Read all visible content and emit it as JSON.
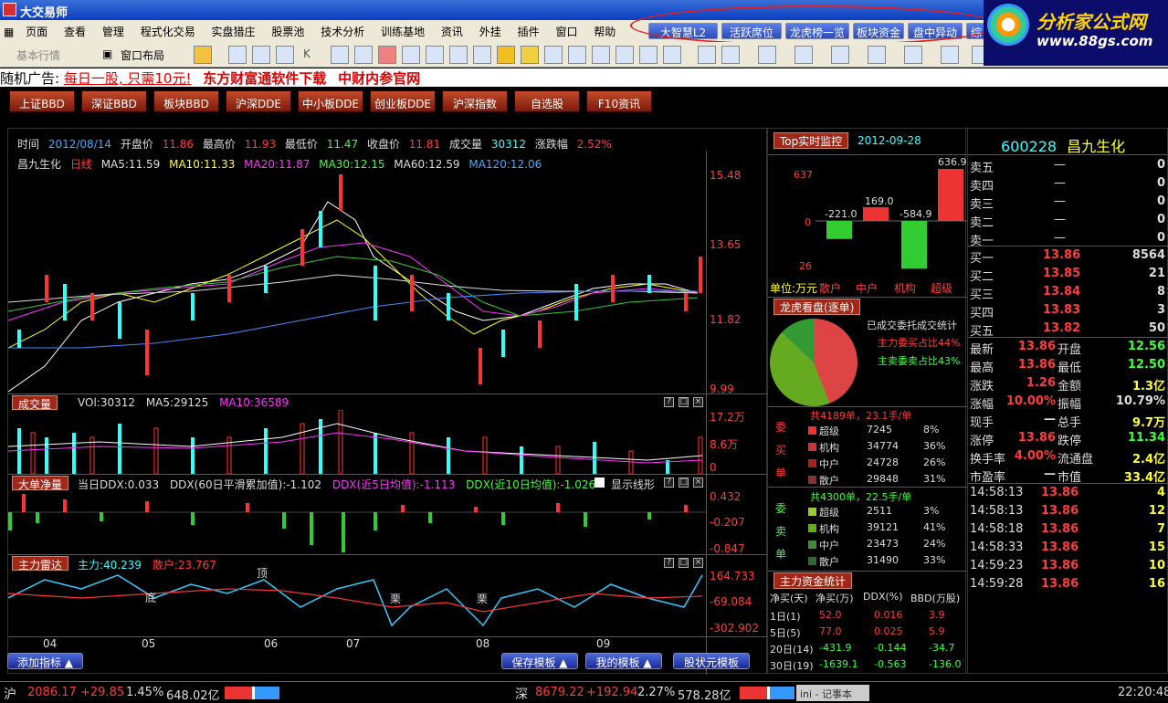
{
  "window": {
    "title": "大交易师"
  },
  "menu": [
    "页面",
    "查看",
    "管理",
    "程式化交易",
    "实盘猎庄",
    "股票池",
    "技术分析",
    "训练基地",
    "资讯",
    "外挂",
    "插件",
    "窗口",
    "帮助"
  ],
  "top_buttons": [
    "大智慧L2",
    "活跃席位",
    "龙虎榜一览",
    "板块资金",
    "盘中异动",
    "综"
  ],
  "logo": {
    "title": "分析家公式网",
    "url": "www.88gs.com"
  },
  "toolbar": {
    "basic_quote": "基本行情",
    "window_layout": "窗口布局",
    "kline_label": "K"
  },
  "ad": {
    "prefix": "随机广告:",
    "text": "每日一股, 只需10元!",
    "link1": "东方财富通软件下载",
    "link2": "中财内参官网"
  },
  "tabs": [
    "上证BBD",
    "深证BBD",
    "板块BBD",
    "沪深DDE",
    "中小板DDE",
    "创业板DDE",
    "沪深指数",
    "自选股",
    "F10资讯"
  ],
  "kline_info": {
    "time_label": "时间",
    "date": "2012/08/14",
    "open_label": "开盘价",
    "open": "11.86",
    "high_label": "最高价",
    "high": "11.93",
    "low_label": "最低价",
    "low": "11.47",
    "close_label": "收盘价",
    "close": "11.81",
    "vol_label": "成交量",
    "vol": "30312",
    "chg_label": "涨跌幅",
    "chg": "2.52%"
  },
  "ma_line": {
    "name": "昌九生化",
    "period": "日线",
    "ma5": "MA5:11.59",
    "ma10": "MA10:11.33",
    "ma20": "MA20:11.87",
    "ma30": "MA30:12.15",
    "ma60": "MA60:12.59",
    "ma120": "MA120:12.06"
  },
  "price_axis": [
    "15.48",
    "13.65",
    "11.82",
    "9.99"
  ],
  "volume": {
    "title": "成交量",
    "vol": "VOl:30312",
    "ma5": "MA5:29125",
    "ma10": "MA10:36589",
    "axis": [
      "17.2万",
      "8.6万",
      "0"
    ]
  },
  "ddx": {
    "title": "大单净量",
    "today": "当日DDX:0.033",
    "avg60": "DDX(60日平滑累加值):-1.102",
    "avg5": "DDX(近5日均值):-1.113",
    "avg10": "DDX(近10日均值):-1.026",
    "show_line": "显示线形",
    "axis": [
      "0.432",
      "-0.207",
      "-0.847"
    ]
  },
  "radar": {
    "title": "主力雷达",
    "main": "主力:40.239",
    "retail": "散户:23.767",
    "axis": [
      "164.733",
      "-69.084",
      "-302.902"
    ],
    "marks": [
      "底",
      "顶",
      "栗",
      "栗"
    ]
  },
  "months": [
    "04",
    "05",
    "06",
    "07",
    "08",
    "09"
  ],
  "bottom_buttons": {
    "add": "添加指标",
    "save": "保存模板",
    "mine": "我的模板",
    "stock": "股状元模板"
  },
  "top_monitor": {
    "title": "Top实时监控",
    "date": "2012-09-28",
    "axis": [
      "637",
      "0",
      "26"
    ],
    "values": [
      "-221.0",
      "169.0",
      "-584.9",
      "636.9"
    ],
    "bar_values": [
      -221.0,
      169.0,
      -584.9,
      636.9
    ],
    "unit": "单位:万元",
    "cats": [
      "散户",
      "中户",
      "机构",
      "超级"
    ]
  },
  "pie": {
    "title": "龙虎看盘(逐单)",
    "l1": "已成交委托成交统计",
    "l2": "主力委买占比44%",
    "l3": "主卖委卖占比43%"
  },
  "buy_stats": {
    "side": [
      "委",
      "买",
      "单"
    ],
    "header": "共4189单，23.1手/单",
    "rows": [
      [
        "超级",
        "7245",
        "8%"
      ],
      [
        "机构",
        "34774",
        "36%"
      ],
      [
        "中户",
        "24728",
        "26%"
      ],
      [
        "散户",
        "29848",
        "31%"
      ]
    ]
  },
  "sell_stats": {
    "side": [
      "委",
      "卖",
      "单"
    ],
    "header": "共4300单，22.5手/单",
    "rows": [
      [
        "超级",
        "2511",
        "3%"
      ],
      [
        "机构",
        "39121",
        "41%"
      ],
      [
        "中户",
        "23473",
        "24%"
      ],
      [
        "散户",
        "31490",
        "33%"
      ]
    ]
  },
  "fund": {
    "title": "主力资金统计",
    "headers": [
      "净买(天)",
      "净买(万)",
      "DDX(%)",
      "BBD(万股)"
    ],
    "rows": [
      [
        "1日(1)",
        "52.0",
        "0.016",
        "3.9"
      ],
      [
        "5日(5)",
        "77.0",
        "0.025",
        "5.9"
      ],
      [
        "20日(14)",
        "-431.9",
        "-0.144",
        "-34.7"
      ],
      [
        "30日(19)",
        "-1639.1",
        "-0.563",
        "-136.0"
      ]
    ]
  },
  "quote": {
    "code": "600228",
    "name": "昌九生化",
    "asks": [
      [
        "卖五",
        "—",
        "0"
      ],
      [
        "卖四",
        "—",
        "0"
      ],
      [
        "卖三",
        "—",
        "0"
      ],
      [
        "卖二",
        "—",
        "0"
      ],
      [
        "卖一",
        "—",
        "0"
      ]
    ],
    "bids": [
      [
        "买一",
        "13.86",
        "8564"
      ],
      [
        "买二",
        "13.85",
        "21"
      ],
      [
        "买三",
        "13.84",
        "8"
      ],
      [
        "买四",
        "13.83",
        "3"
      ],
      [
        "买五",
        "13.82",
        "50"
      ]
    ],
    "stats": [
      [
        "最新",
        "13.86",
        "开盘",
        "12.56"
      ],
      [
        "最高",
        "13.86",
        "最低",
        "12.50"
      ],
      [
        "涨跌",
        "1.26",
        "金额",
        "1.3亿"
      ],
      [
        "涨幅",
        "10.00%",
        "振幅",
        "10.79%"
      ],
      [
        "现手",
        "—",
        "总手",
        "9.7万"
      ],
      [
        "涨停",
        "13.86",
        "跌停",
        "11.34"
      ],
      [
        "换手率",
        "4.00%",
        "流通盘",
        "2.4亿"
      ],
      [
        "市盈率",
        "—",
        "市值",
        "33.4亿"
      ]
    ],
    "ticks": [
      [
        "14:58:13",
        "13.86",
        "4"
      ],
      [
        "14:58:13",
        "13.86",
        "12"
      ],
      [
        "14:58:18",
        "13.86",
        "7"
      ],
      [
        "14:58:33",
        "13.86",
        "15"
      ],
      [
        "14:59:23",
        "13.86",
        "10"
      ],
      [
        "14:59:28",
        "13.86",
        "16"
      ]
    ]
  },
  "status": {
    "sh_label": "沪",
    "sh_idx": "2086.17",
    "sh_chg": "+29.85",
    "sh_pct": "1.45%",
    "sh_amt": "648.02亿",
    "sz_label": "深",
    "sz_idx": "8679.22",
    "sz_chg": "+192.94",
    "sz_pct": "2.27%",
    "sz_amt": "578.28亿",
    "task": "ini - 记事本",
    "clock": "22:20:48"
  },
  "colors": {
    "up": "#ff3c3c",
    "down": "#3cff3c",
    "accent": "#a02818"
  }
}
